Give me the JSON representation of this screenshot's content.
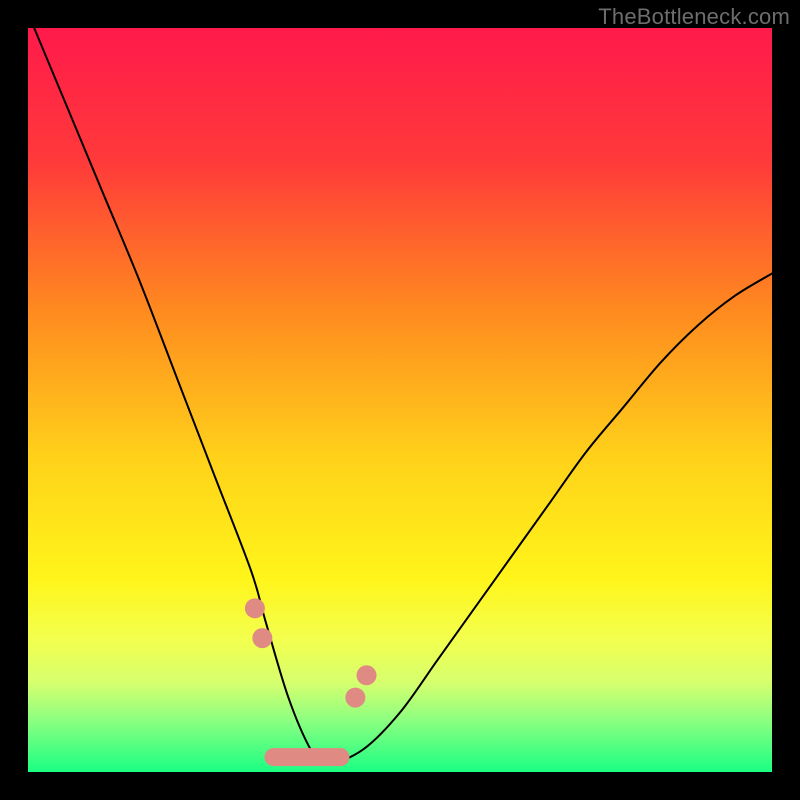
{
  "watermark": "TheBottleneck.com",
  "colors": {
    "frame_bg": "#000000",
    "curve_stroke": "#000000",
    "marker_fill": "#e08a84",
    "gradient_stops": [
      {
        "pct": 0,
        "color": "#ff1a4b"
      },
      {
        "pct": 18,
        "color": "#ff3a3a"
      },
      {
        "pct": 38,
        "color": "#ff8a1f"
      },
      {
        "pct": 58,
        "color": "#ffd21a"
      },
      {
        "pct": 74,
        "color": "#fff51a"
      },
      {
        "pct": 82,
        "color": "#f3ff4d"
      },
      {
        "pct": 88,
        "color": "#d6ff6e"
      },
      {
        "pct": 93,
        "color": "#8dff80"
      },
      {
        "pct": 100,
        "color": "#1aff83"
      }
    ]
  },
  "chart_data": {
    "type": "line",
    "title": "",
    "xlabel": "",
    "ylabel": "",
    "xlim": [
      0,
      100
    ],
    "ylim": [
      0,
      100
    ],
    "x": [
      0,
      5,
      10,
      15,
      20,
      25,
      30,
      32,
      35,
      38,
      40,
      45,
      50,
      55,
      60,
      65,
      70,
      75,
      80,
      85,
      90,
      95,
      100
    ],
    "series": [
      {
        "name": "bottleneck-curve",
        "values": [
          102,
          90,
          78,
          66,
          53,
          40,
          27,
          20,
          10,
          3,
          1,
          3,
          8,
          15,
          22,
          29,
          36,
          43,
          49,
          55,
          60,
          64,
          67
        ]
      }
    ],
    "markers": [
      {
        "x": 30.5,
        "y": 22
      },
      {
        "x": 31.5,
        "y": 18
      },
      {
        "x": 44,
        "y": 10
      },
      {
        "x": 45.5,
        "y": 13
      }
    ],
    "flat_segment_y": 2,
    "flat_segment_x": [
      33,
      42
    ]
  }
}
